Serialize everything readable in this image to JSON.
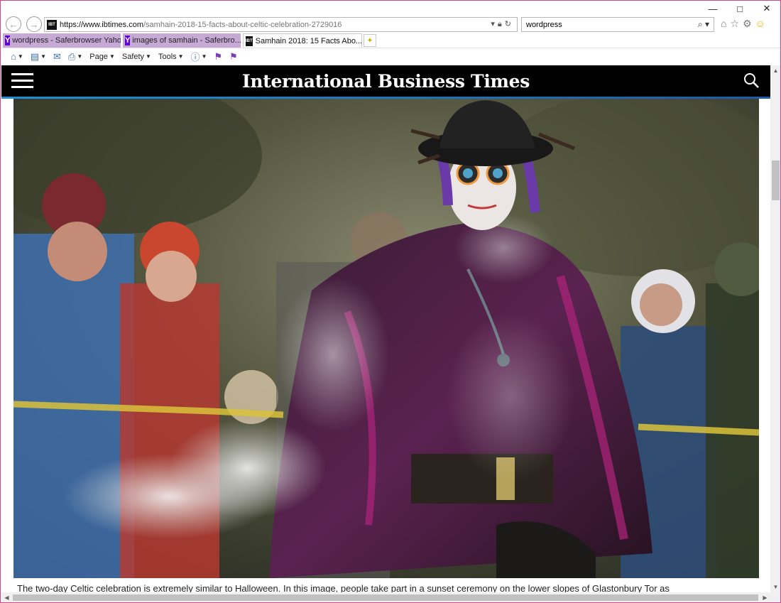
{
  "browser": {
    "address": {
      "host": "https://www.ibtimes.com",
      "path": "/samhain-2018-15-facts-about-celtic-celebration-2729016",
      "favicon_text": "IBT"
    },
    "search": {
      "value": "wordpress"
    },
    "tabs": [
      {
        "label": "wordpress - Saferbrowser Yaho...",
        "favicon": "Y"
      },
      {
        "label": "images of samhain - Saferbro...",
        "favicon": "Y"
      },
      {
        "label": "Samhain 2018: 15 Facts Abo...",
        "favicon": "IBT"
      }
    ],
    "command_bar": {
      "page": "Page",
      "safety": "Safety",
      "tools": "Tools"
    },
    "icons": {
      "back": "back-arrow-icon",
      "forward": "forward-arrow-icon",
      "home": "home-icon",
      "favorites": "star-icon",
      "settings": "gear-icon",
      "feedback": "smiley-icon"
    }
  },
  "site": {
    "title": "International Business Times",
    "header_color": "#000000",
    "accent_color": "#1d8fd8"
  },
  "article": {
    "image_caption": "The two-day Celtic celebration is extremely similar to Halloween. In this image, people take part in a sunset ceremony on the lower slopes of Glastonbury Tor as"
  }
}
